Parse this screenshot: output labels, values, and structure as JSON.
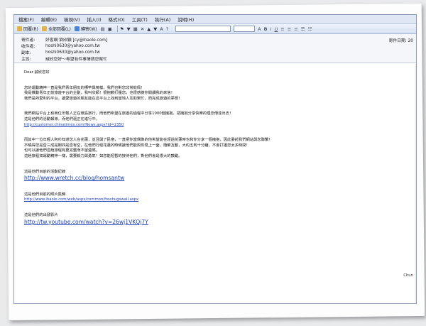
{
  "menu": [
    "檔案(F)",
    "編輯(E)",
    "檢視(V)",
    "插入(I)",
    "格式(O)",
    "工具(T)",
    "執行(A)",
    "說明(H)"
  ],
  "toolbar": {
    "reply": "回覆(R)",
    "reply_all": "全部回覆(L)",
    "forward": "轉寄(W)"
  },
  "header": {
    "from_label": "寄件者:",
    "from_value": "好客網 劉欣穎 [cy@ihaole.com]",
    "to_label": "收件者:",
    "to_value": "hoshi0630@yahoo.com.tw",
    "cc_label": "副本:",
    "cc_value": "hoshi0630@yahoo.com.tw",
    "subject_label": "主旨:",
    "subject_value": "誠欣您好～希望有件事情請您幫忙",
    "sent_label": "寄件日期:",
    "sent_value": "20"
  },
  "body": {
    "greeting": "Dear 誠欣您好",
    "p1_l1": "您的運動精神一直是我們青年朋友的標竿與榜樣，我們也對您非常欽佩！",
    "p1_l2": "我是推動青年正前旅遊平台的企劃，我叫欣穎！很抱歉打擾您，也很感謝你閱讀我的來信！",
    "p1_l3": "我們是熱愛利的平台，讓愛旅遊的朋友能在這平台上找到當地人互助幫忙，而完成旅遊的夢想！",
    "p2_l1": "我們網站平台上有兩位年輕人正在環島旅行，而他們希望在旅遊的過程中分享1000個擁抱，把擁抱分享快樂的理念傳達出去！",
    "p2_l2": "這是他們的活動報導，而他們還正在進行中。",
    "link1": "http://customer.chinatimes.com/News.aspx?id=2350",
    "p3_l1": "而其中一位年輕人阿杉知道您人在花蓮，並且開了民宿，一直把你當偶像的他希望能在經過花蓮時也和你分享一個擁抱，因此委託我們網站與您聯繫！",
    "p3_l2": "不曉得您是否三成是期四是否有空，在他們行經花蓮的時候讓他們能與你見上一面，隨聚互動，大約五到十分鐘，不會打擾您太多時間！",
    "p3_l3": "也可以讓他們這趟旅程有更完整而不留遺憾。",
    "p3_l4": "這趟旅程如運動精神一樣，需要毅力與勇氣！如您能短暫的接待他們，對他們會是很大的鼓勵。",
    "sec1_label": "這是他們目前的活動紀錄",
    "link2": "http://www.wretch.cc/blog/homsantw",
    "sec2_label": "這是他們目前的照片集錦",
    "link3": "http://www.ihaole.com/web/aspx/common/freehugswall.aspx",
    "sec3_label": "這是他們的出發影片",
    "link4": "http://tw.youtube.com/watch?v=26wj1VKQj7Y",
    "signature": "Chun"
  }
}
